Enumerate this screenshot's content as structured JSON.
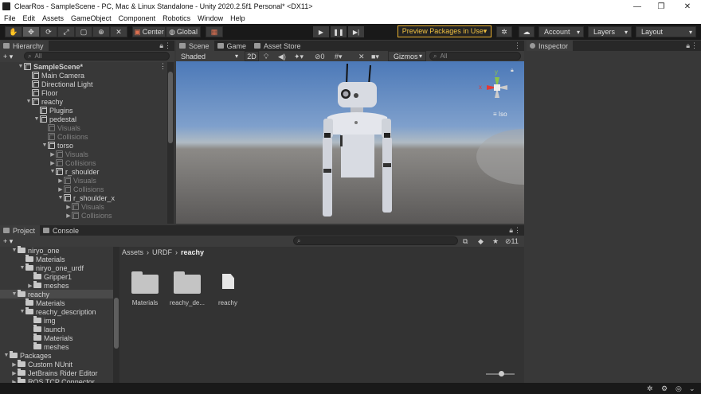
{
  "window": {
    "title": "ClearRos - SampleScene - PC, Mac & Linux Standalone - Unity 2020.2.5f1 Personal* <DX11>",
    "minimize": "—",
    "maximize": "❐",
    "close": "✕"
  },
  "menu": [
    "File",
    "Edit",
    "Assets",
    "GameObject",
    "Component",
    "Robotics",
    "Window",
    "Help"
  ],
  "toolbar": {
    "center_label": "Center",
    "global_label": "Global",
    "preview_label": "Preview Packages in Use▾",
    "account_label": "Account",
    "layers_label": "Layers",
    "layout_label": "Layout"
  },
  "hierarchy": {
    "tab": "Hierarchy",
    "add": "+ ▾",
    "search_placeholder": "All",
    "items": [
      {
        "label": "SampleScene*",
        "indent": 0,
        "arrow": "▼",
        "dim": false,
        "bold": true
      },
      {
        "label": "Main Camera",
        "indent": 1,
        "arrow": "",
        "dim": false
      },
      {
        "label": "Directional Light",
        "indent": 1,
        "arrow": "",
        "dim": false
      },
      {
        "label": "Floor",
        "indent": 1,
        "arrow": "",
        "dim": false
      },
      {
        "label": "reachy",
        "indent": 1,
        "arrow": "▼",
        "dim": false
      },
      {
        "label": "Plugins",
        "indent": 2,
        "arrow": "",
        "dim": false
      },
      {
        "label": "pedestal",
        "indent": 2,
        "arrow": "▼",
        "dim": false
      },
      {
        "label": "Visuals",
        "indent": 3,
        "arrow": "",
        "dim": true
      },
      {
        "label": "Collisions",
        "indent": 3,
        "arrow": "",
        "dim": true
      },
      {
        "label": "torso",
        "indent": 3,
        "arrow": "▼",
        "dim": false
      },
      {
        "label": "Visuals",
        "indent": 4,
        "arrow": "▶",
        "dim": true
      },
      {
        "label": "Collisions",
        "indent": 4,
        "arrow": "▶",
        "dim": true
      },
      {
        "label": "r_shoulder",
        "indent": 4,
        "arrow": "▼",
        "dim": false
      },
      {
        "label": "Visuals",
        "indent": 5,
        "arrow": "▶",
        "dim": true
      },
      {
        "label": "Collisions",
        "indent": 5,
        "arrow": "▶",
        "dim": true
      },
      {
        "label": "r_shoulder_x",
        "indent": 5,
        "arrow": "▼",
        "dim": false
      },
      {
        "label": "Visuals",
        "indent": 6,
        "arrow": "▶",
        "dim": true
      },
      {
        "label": "Collisions",
        "indent": 6,
        "arrow": "▶",
        "dim": true
      }
    ]
  },
  "scene": {
    "tabs": [
      "Scene",
      "Game",
      "Asset Store"
    ],
    "shading": "Shaded",
    "mode_2d": "2D",
    "gizmo_count": "0",
    "gizmos_label": "Gizmos",
    "search_placeholder": "All",
    "persp_label": "Iso",
    "axis_y": "y",
    "axis_x": "x"
  },
  "inspector": {
    "tab": "Inspector"
  },
  "project": {
    "tabs": [
      "Project",
      "Console"
    ],
    "add": "+ ▾",
    "hidden_count": "11",
    "breadcrumb": [
      "Assets",
      "URDF",
      "reachy"
    ],
    "tree": [
      {
        "label": "niryo_one",
        "indent": 1,
        "arrow": "▼",
        "sel": false
      },
      {
        "label": "Materials",
        "indent": 2,
        "arrow": "",
        "sel": false
      },
      {
        "label": "niryo_one_urdf",
        "indent": 2,
        "arrow": "▼",
        "sel": false
      },
      {
        "label": "Gripper1",
        "indent": 3,
        "arrow": "",
        "sel": false
      },
      {
        "label": "meshes",
        "indent": 3,
        "arrow": "▶",
        "sel": false
      },
      {
        "label": "reachy",
        "indent": 1,
        "arrow": "▼",
        "sel": true
      },
      {
        "label": "Materials",
        "indent": 2,
        "arrow": "",
        "sel": false
      },
      {
        "label": "reachy_description",
        "indent": 2,
        "arrow": "▼",
        "sel": false
      },
      {
        "label": "img",
        "indent": 3,
        "arrow": "",
        "sel": false
      },
      {
        "label": "launch",
        "indent": 3,
        "arrow": "",
        "sel": false
      },
      {
        "label": "Materials",
        "indent": 3,
        "arrow": "",
        "sel": false
      },
      {
        "label": "meshes",
        "indent": 3,
        "arrow": "",
        "sel": false
      },
      {
        "label": "Packages",
        "indent": 0,
        "arrow": "▼",
        "sel": false
      },
      {
        "label": "Custom NUnit",
        "indent": 1,
        "arrow": "▶",
        "sel": false
      },
      {
        "label": "JetBrains Rider Editor",
        "indent": 1,
        "arrow": "▶",
        "sel": false
      },
      {
        "label": "ROS TCP Connector",
        "indent": 1,
        "arrow": "▶",
        "sel": false
      }
    ],
    "assets": [
      {
        "label": "Materials",
        "type": "folder"
      },
      {
        "label": "reachy_de...",
        "type": "folder"
      },
      {
        "label": "reachy",
        "type": "file"
      }
    ]
  }
}
